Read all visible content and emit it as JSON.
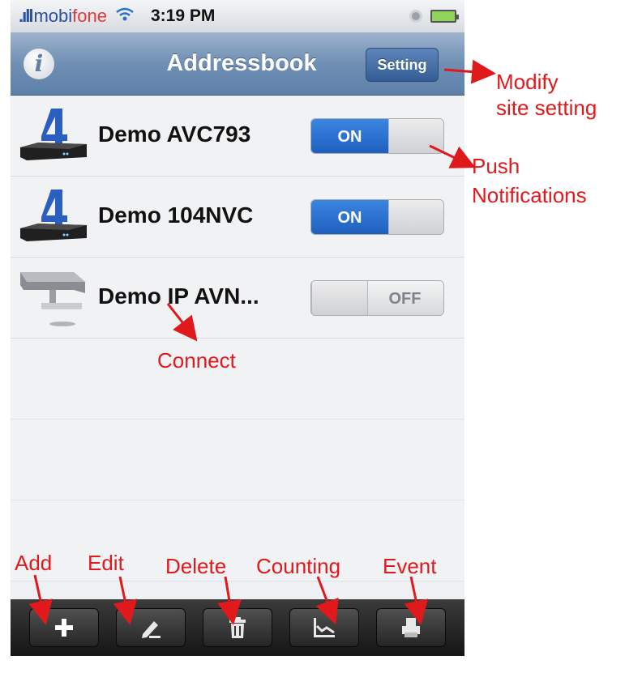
{
  "status_bar": {
    "signal_glyph": ".ıll",
    "carrier_part1": "mobi",
    "carrier_part2": "fone",
    "time": "3:19 PM"
  },
  "nav": {
    "title": "Addressbook",
    "setting_label": "Setting"
  },
  "sites": [
    {
      "name": "Demo AVC793",
      "push_state": "ON",
      "icon": "dvr-recorder-icon"
    },
    {
      "name": "Demo 104NVC",
      "push_state": "ON",
      "icon": "dvr-recorder-icon"
    },
    {
      "name": "Demo IP AVN...",
      "push_state": "OFF",
      "icon": "ip-camera-icon"
    }
  ],
  "toolbar": [
    {
      "name": "add",
      "icon": "plus-icon"
    },
    {
      "name": "edit",
      "icon": "pencil-icon"
    },
    {
      "name": "delete",
      "icon": "trash-icon"
    },
    {
      "name": "counting",
      "icon": "chart-line-icon"
    },
    {
      "name": "event",
      "icon": "printer-icon"
    }
  ],
  "annotations": {
    "modify_line1": "Modify",
    "modify_line2": "site setting",
    "push_line1": "Push",
    "push_line2": "Notifications",
    "connect": "Connect",
    "add": "Add",
    "edit": "Edit",
    "delete": "Delete",
    "counting": "Counting",
    "event": "Event"
  },
  "colors": {
    "annotation_red": "#e0191d",
    "nav_blue": "#6f8fb4",
    "switch_on_blue": "#2a72d3"
  }
}
